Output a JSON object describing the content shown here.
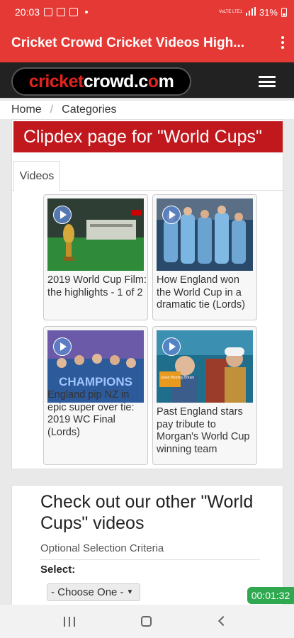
{
  "status_bar": {
    "time": "20:03",
    "network_label": "VoLTE LTE1",
    "battery": "31%"
  },
  "app_bar": {
    "title": "Cricket Crowd Cricket Videos High..."
  },
  "site": {
    "logo_red": "cricket",
    "logo_white": "crowd.c",
    "logo_red2": "o",
    "logo_white2": "m"
  },
  "breadcrumb": {
    "home": "Home",
    "separator": "/",
    "current": "Categories"
  },
  "main": {
    "heading": "Clipdex page for \"World Cups\"",
    "tabs": [
      {
        "label": "Videos"
      }
    ],
    "videos": [
      {
        "title": "2019 World Cup Film: the highlights - 1 of 2"
      },
      {
        "title": "How England won the World Cup in a dramatic tie (Lords)"
      },
      {
        "title": "England pip NZ in epic super over tie: 2019 WC Final (Lords)"
      },
      {
        "title": "Past England stars pay tribute to Morgan's World Cup winning team"
      }
    ],
    "thumb3_overlay": "CHAMPIONS",
    "thumb4_overlay": "Good Morning Britain"
  },
  "other": {
    "heading": "Check out our other \"World Cups\" videos",
    "criteria": "Optional Selection Criteria",
    "select_label": "Select:",
    "dropdown_value": "- Choose One -",
    "dropdown_caret": "▼"
  },
  "overlay_timer": "00:01:32"
}
